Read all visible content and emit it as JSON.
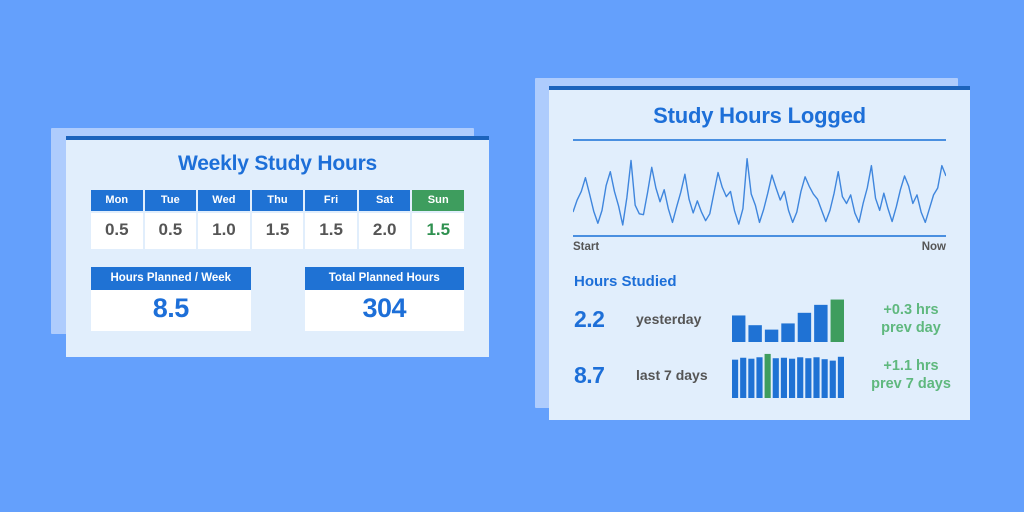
{
  "theme": {
    "background": "#64a0fc",
    "card_back": "#aeccfd",
    "card_face": "#e1eefc",
    "brand_blue": "#1d6fd8",
    "header_blue": "#1f72d4",
    "rule_blue": "#1b63bc",
    "accent_green": "#3e9d5e",
    "delta_green": "#5fb87e",
    "value_gray": "#555555"
  },
  "left_card": {
    "title": "Weekly Study Hours",
    "week": {
      "days": [
        "Mon",
        "Tue",
        "Wed",
        "Thu",
        "Fri",
        "Sat",
        "Sun"
      ],
      "values": [
        "0.5",
        "0.5",
        "1.0",
        "1.5",
        "1.5",
        "2.0",
        "1.5"
      ],
      "highlight_index": 6
    },
    "kpis": [
      {
        "label": "Hours Planned  / Week",
        "value": "8.5"
      },
      {
        "label": "Total Planned Hours",
        "value": "304"
      }
    ]
  },
  "right_card": {
    "title": "Study Hours Logged",
    "axis": {
      "start": "Start",
      "end": "Now"
    },
    "section_label": "Hours Studied",
    "stats": [
      {
        "value": "2.2",
        "label": "yesterday",
        "delta": "+0.3 hrs",
        "delta_sub": "prev day"
      },
      {
        "value": "8.7",
        "label": "last 7 days",
        "delta": "+1.1 hrs",
        "delta_sub": "prev 7 days"
      }
    ]
  },
  "chart_data": [
    {
      "type": "line",
      "name": "study-hours-sparkline",
      "title": "Study Hours Logged",
      "xlabel": "",
      "ylabel": "",
      "grid": false,
      "legend": "none",
      "xticks": [
        "Start",
        "Now"
      ],
      "ylim": [
        0,
        10
      ],
      "x": [
        0,
        1,
        2,
        3,
        4,
        5,
        6,
        7,
        8,
        9,
        10,
        11,
        12,
        13,
        14,
        15,
        16,
        17,
        18,
        19,
        20,
        21,
        22,
        23,
        24,
        25,
        26,
        27,
        28,
        29,
        30,
        31,
        32,
        33,
        34,
        35,
        36,
        37,
        38,
        39,
        40,
        41,
        42,
        43,
        44,
        45,
        46,
        47,
        48,
        49,
        50,
        51,
        52,
        53,
        54,
        55,
        56,
        57,
        58,
        59,
        60,
        61,
        62,
        63,
        64,
        65,
        66,
        67,
        68,
        69,
        70,
        71,
        72,
        73,
        74,
        75,
        76,
        77,
        78,
        79,
        80,
        81,
        82,
        83,
        84,
        85,
        86,
        87,
        88,
        89,
        90
      ],
      "values": [
        2.2,
        3.6,
        4.6,
        6.2,
        4.3,
        2.3,
        0.9,
        2.4,
        5.3,
        6.9,
        4.6,
        2.9,
        0.7,
        3.9,
        8.2,
        3.0,
        2.0,
        1.9,
        4.5,
        7.4,
        5.0,
        3.4,
        4.8,
        2.6,
        1.0,
        2.8,
        4.5,
        6.6,
        3.7,
        2.1,
        3.5,
        2.2,
        1.2,
        2.0,
        4.4,
        6.8,
        5.1,
        4.0,
        4.6,
        2.3,
        0.8,
        2.6,
        8.4,
        4.3,
        3.0,
        1.0,
        2.5,
        4.4,
        6.5,
        5.0,
        3.6,
        4.6,
        2.4,
        1.0,
        2.2,
        4.6,
        6.3,
        5.2,
        4.3,
        3.7,
        2.4,
        1.1,
        2.4,
        4.4,
        6.9,
        4.0,
        3.2,
        4.2,
        2.1,
        1.0,
        3.2,
        5.0,
        7.6,
        3.8,
        2.4,
        4.4,
        2.6,
        1.1,
        2.8,
        4.8,
        6.4,
        5.2,
        3.2,
        4.2,
        2.2,
        1.0,
        2.6,
        4.2,
        5.0,
        7.6,
        6.4
      ]
    },
    {
      "type": "bar",
      "name": "yesterday-minibars",
      "categories": [
        "d1",
        "d2",
        "d3",
        "d4",
        "d5",
        "d6",
        "d7"
      ],
      "values": [
        1.5,
        0.95,
        0.7,
        1.05,
        1.65,
        2.1,
        2.4
      ],
      "highlight_index": 6,
      "title": "",
      "ylim": [
        0,
        2.6
      ]
    },
    {
      "type": "bar",
      "name": "last-7-days-minibars",
      "categories": [
        "w1",
        "w2",
        "w3",
        "w4",
        "w5",
        "w6",
        "w7",
        "w8",
        "w9",
        "w10",
        "w11",
        "w12",
        "w13",
        "w14"
      ],
      "values": [
        8.0,
        8.4,
        8.2,
        8.5,
        9.2,
        8.3,
        8.4,
        8.2,
        8.5,
        8.3,
        8.5,
        8.1,
        7.8,
        8.6
      ],
      "highlight_index": 4,
      "title": "",
      "ylim": [
        0,
        9.6
      ]
    }
  ]
}
